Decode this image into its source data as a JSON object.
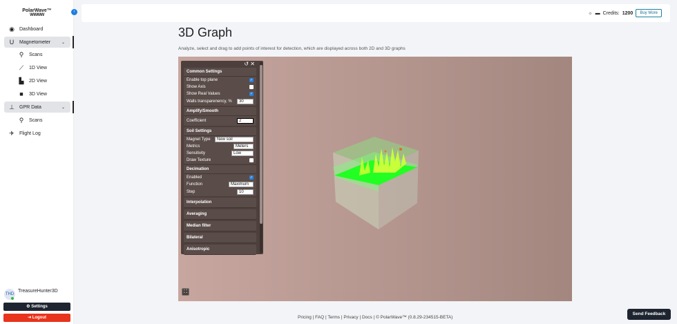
{
  "app": {
    "name": "PolarWave™",
    "logo_text": "WWWW"
  },
  "sidebar": {
    "items": [
      {
        "label": "Dashboard",
        "icon": "dashboard-icon"
      },
      {
        "label": "Magnetometer",
        "icon": "magnet-icon"
      },
      {
        "label": "Scans",
        "icon": "search-icon"
      },
      {
        "label": "1D View",
        "icon": "line-chart-icon"
      },
      {
        "label": "2D View",
        "icon": "bar-chart-icon"
      },
      {
        "label": "3D View",
        "icon": "cube-icon"
      },
      {
        "label": "GPR Data",
        "icon": "gpr-icon"
      },
      {
        "label": "Scans",
        "icon": "search-icon"
      },
      {
        "label": "Flight Log",
        "icon": "plane-icon"
      }
    ],
    "user": {
      "initials": "THD",
      "name": "TreasureHunter3D"
    },
    "settings_label": "Settings",
    "logout_label": "Logout"
  },
  "header": {
    "credits_label": "Credits:",
    "credits": "1200",
    "buy_label": "Buy More"
  },
  "page": {
    "title": "3D Graph",
    "subtitle": "Analyze, select and drag to add points of interest for detection, which are displayed across both 2D and 3D graphs"
  },
  "panel": {
    "common": {
      "title": "Common Settings",
      "enable_top": "Enable top plane",
      "show_axis": "Show Axis",
      "show_real": "Show Real Values",
      "walls": "Walls transparenency, %",
      "walls_value": "30"
    },
    "amplify": {
      "title": "Amplify/Smooth",
      "coefficient": "Coefficient",
      "coefficient_value": "2"
    },
    "soil": {
      "title": "Soil Settings",
      "magnet_type": "Magnet Type",
      "magnet_value": "New soil",
      "metrics": "Metrics",
      "metrics_value": "Meters",
      "sensitivity": "Sensitivity",
      "sensitivity_value": "Low",
      "draw_texture": "Draw Texture"
    },
    "decimation": {
      "title": "Decimation",
      "enabled": "Enabled",
      "function": "Function",
      "function_value": "Maximum",
      "step": "Step",
      "step_value": "10"
    },
    "collapsed": [
      "Interpolation",
      "Averaging",
      "Median filter",
      "Bilateral",
      "Anisotropic"
    ]
  },
  "footer": {
    "text": "Pricing | FAQ | Terms | Privacy | Docs | © PolarWave™ (0.8.29-234515-BETA)",
    "feedback": "Send Feedback"
  },
  "colors": {
    "accent": "#1b7fe0",
    "logout": "#e8341c",
    "dark": "#1e2530",
    "surface": "#00ff22"
  }
}
